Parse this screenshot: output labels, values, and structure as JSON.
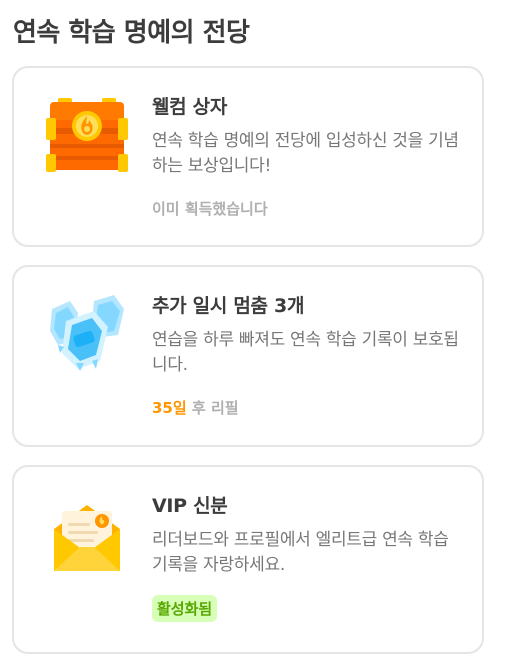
{
  "page": {
    "title": "연속 학습 명예의 전당"
  },
  "cards": [
    {
      "icon": "treasure-chest-icon",
      "title": "웰컴 상자",
      "description": "연속 학습 명예의 전당에 입성하신 것을 기념하는 보상입니다!",
      "status": "이미 획득했습니다"
    },
    {
      "icon": "streak-freeze-icon",
      "title": "추가 일시 멈춤 3개",
      "description": "연습을 하루 빠져도 연속 학습 기록이 보호됩니다.",
      "refill_days": "35일",
      "refill_suffix": "후 리필"
    },
    {
      "icon": "vip-invitation-icon",
      "title": "VIP 신분",
      "description": "리더보드와 프로필에서 엘리트급 연속 학습 기록을 자랑하세요.",
      "badge": "활성화됨"
    }
  ],
  "colors": {
    "accent_orange": "#ff9600",
    "badge_green_bg": "#d7ffb8",
    "badge_green_text": "#58a700",
    "muted": "#afafaf"
  }
}
